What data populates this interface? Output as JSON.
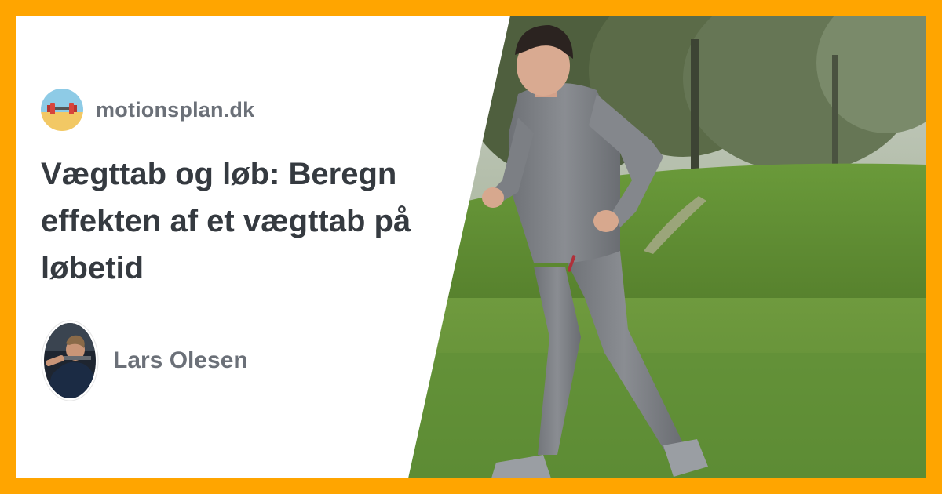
{
  "site": {
    "name": "motionsplan.dk",
    "logo_icon": "barbell-on-beach-icon"
  },
  "article": {
    "title": "Vægttab og løb: Beregn effekten af et vægttab på løbetid"
  },
  "author": {
    "name": "Lars Olesen"
  },
  "colors": {
    "frame": "#ffa500",
    "panel": "#ffffff",
    "title": "#353a40",
    "muted_text": "#6b7078"
  }
}
